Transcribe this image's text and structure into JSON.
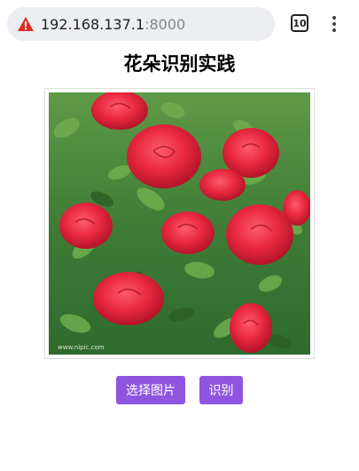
{
  "browser": {
    "url_host": "192.168.137.1",
    "url_port": ":8000",
    "tab_count": "10",
    "security_icon": "warning-triangle-icon",
    "menu_icon": "more-vertical-icon"
  },
  "page": {
    "title": "花朵识别实践",
    "image_alt": "rose flowers photo",
    "watermark": "www.nipic.com"
  },
  "buttons": {
    "choose_label": "选择图片",
    "identify_label": "识别"
  },
  "colors": {
    "accent": "#8f55e0",
    "warning": "#d93025"
  }
}
